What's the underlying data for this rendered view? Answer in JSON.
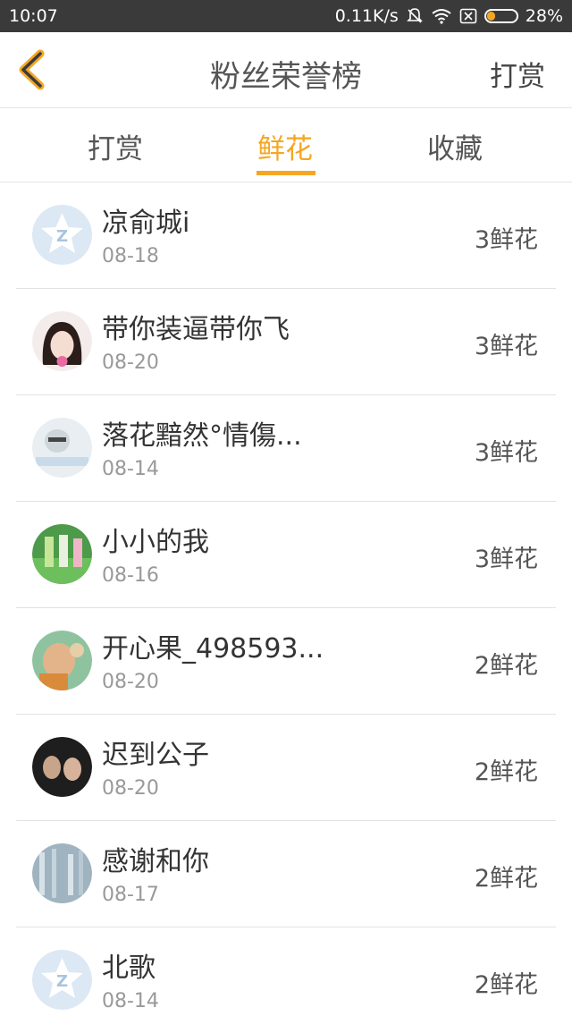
{
  "status_bar": {
    "time": "10:07",
    "network_speed": "0.11K/s",
    "battery": "28%",
    "battery_level": 0.28
  },
  "header": {
    "title": "粉丝荣誉榜",
    "action_label": "打赏"
  },
  "tabs": [
    {
      "label": "打赏",
      "active": false
    },
    {
      "label": "鲜花",
      "active": true
    },
    {
      "label": "收藏",
      "active": false
    }
  ],
  "accent_color": "#f5a623",
  "fans": [
    {
      "name": "凉俞城i",
      "date": "08-18",
      "count": "3鲜花",
      "avatar": "default-avatar-icon"
    },
    {
      "name": "带你装逼带你飞",
      "date": "08-20",
      "count": "3鲜花",
      "avatar": "user-avatar"
    },
    {
      "name": "落花黯然°情傷...",
      "date": "08-14",
      "count": "3鲜花",
      "avatar": "user-avatar"
    },
    {
      "name": "小小的我",
      "date": "08-16",
      "count": "3鲜花",
      "avatar": "user-avatar"
    },
    {
      "name": "开心果_498593...",
      "date": "08-20",
      "count": "2鲜花",
      "avatar": "user-avatar"
    },
    {
      "name": "迟到公子",
      "date": "08-20",
      "count": "2鲜花",
      "avatar": "user-avatar"
    },
    {
      "name": "感谢和你",
      "date": "08-17",
      "count": "2鲜花",
      "avatar": "user-avatar"
    },
    {
      "name": "北歌",
      "date": "08-14",
      "count": "2鲜花",
      "avatar": "default-avatar-icon"
    }
  ]
}
